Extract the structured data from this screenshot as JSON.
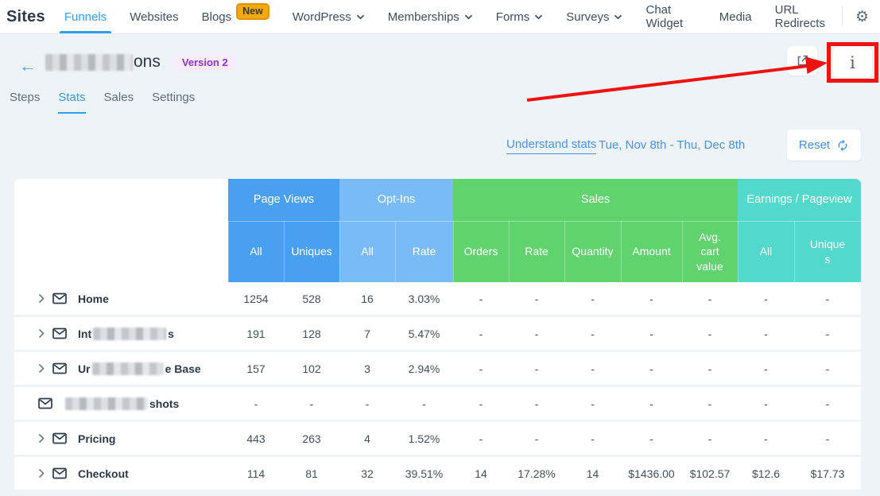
{
  "nav": {
    "brand": "Sites",
    "items": [
      {
        "label": "Funnels",
        "active": true
      },
      {
        "label": "Websites"
      },
      {
        "label": "Blogs",
        "badge": "New"
      },
      {
        "label": "WordPress",
        "caret": true
      },
      {
        "label": "Memberships",
        "caret": true
      },
      {
        "label": "Forms",
        "caret": true
      },
      {
        "label": "Surveys",
        "caret": true
      },
      {
        "label": "Chat Widget"
      },
      {
        "label": "Media"
      },
      {
        "label": "URL Redirects"
      }
    ]
  },
  "header": {
    "title_suffix": "ons",
    "title_redacted_width": 110,
    "version_badge": "Version 2"
  },
  "tabs": [
    {
      "label": "Steps"
    },
    {
      "label": "Stats",
      "active": true
    },
    {
      "label": "Sales"
    },
    {
      "label": "Settings"
    }
  ],
  "controls": {
    "understand_link": "Understand stats",
    "date_range": "Tue, Nov 8th - Thu, Dec 8th",
    "reset_label": "Reset"
  },
  "table": {
    "groups": [
      {
        "label": "Page Views",
        "color": "#4aa0f0",
        "columns": [
          "All",
          "Uniques"
        ]
      },
      {
        "label": "Opt-Ins",
        "color": "#79bbf6",
        "columns": [
          "All",
          "Rate"
        ]
      },
      {
        "label": "Sales",
        "color": "#60d26e",
        "columns": [
          "Orders",
          "Rate",
          "Quantity",
          "Amount",
          "Avg. cart value"
        ]
      },
      {
        "label": "Earnings / Pageview",
        "color": "#52d9cc",
        "columns": [
          "All",
          "Uniques"
        ]
      }
    ],
    "rows": [
      {
        "expandable": true,
        "name_parts": [
          {
            "text": "Home"
          }
        ],
        "values": [
          "1254",
          "528",
          "16",
          "3.03%",
          "-",
          "-",
          "-",
          "-",
          "-",
          "-",
          "-"
        ]
      },
      {
        "expandable": true,
        "name_parts": [
          {
            "text": "Int"
          },
          {
            "redacted": 92
          },
          {
            "text": "s"
          }
        ],
        "values": [
          "191",
          "128",
          "7",
          "5.47%",
          "-",
          "-",
          "-",
          "-",
          "-",
          "-",
          "-"
        ]
      },
      {
        "expandable": true,
        "name_parts": [
          {
            "text": "Ur"
          },
          {
            "redacted": 90
          },
          {
            "text": "e Base"
          }
        ],
        "values": [
          "157",
          "102",
          "3",
          "2.94%",
          "-",
          "-",
          "-",
          "-",
          "-",
          "-",
          "-"
        ]
      },
      {
        "expandable": false,
        "name_parts": [
          {
            "redacted": 104
          },
          {
            "text": "shots"
          }
        ],
        "values": [
          "-",
          "-",
          "-",
          "-",
          "-",
          "-",
          "-",
          "-",
          "-",
          "-",
          "-"
        ]
      },
      {
        "expandable": true,
        "name_parts": [
          {
            "text": "Pricing"
          }
        ],
        "values": [
          "443",
          "263",
          "4",
          "1.52%",
          "-",
          "-",
          "-",
          "-",
          "-",
          "-",
          "-"
        ]
      },
      {
        "expandable": true,
        "name_parts": [
          {
            "text": "Checkout"
          }
        ],
        "values": [
          "114",
          "81",
          "32",
          "39.51%",
          "14",
          "17.28%",
          "14",
          "$1436.00",
          "$102.57",
          "$12.6",
          "$17.73"
        ]
      }
    ]
  },
  "icons": {
    "back": "arrow-left-icon",
    "settings": "gear-icon",
    "external": "external-link-icon",
    "info": "info-icon",
    "info_glyph": "i",
    "refresh": "refresh-icon",
    "expand": "chevron-right-icon",
    "dropdown": "chevron-down-icon",
    "page": "envelope-icon",
    "settings_glyph": "⚙",
    "back_glyph": "←"
  },
  "colors": {
    "nav_active": "#2e9ff2",
    "link_blue": "#4793ea",
    "page_views_header": "#4aa0f0",
    "opt_ins_header": "#79bbf6",
    "sales_header": "#60d26e",
    "earnings_header": "#52d9cc",
    "new_badge_bg": "#f6a90f",
    "version_badge_text": "#9031c9",
    "annotation_red": "#ec1310",
    "page_bg": "#eef3f8"
  }
}
